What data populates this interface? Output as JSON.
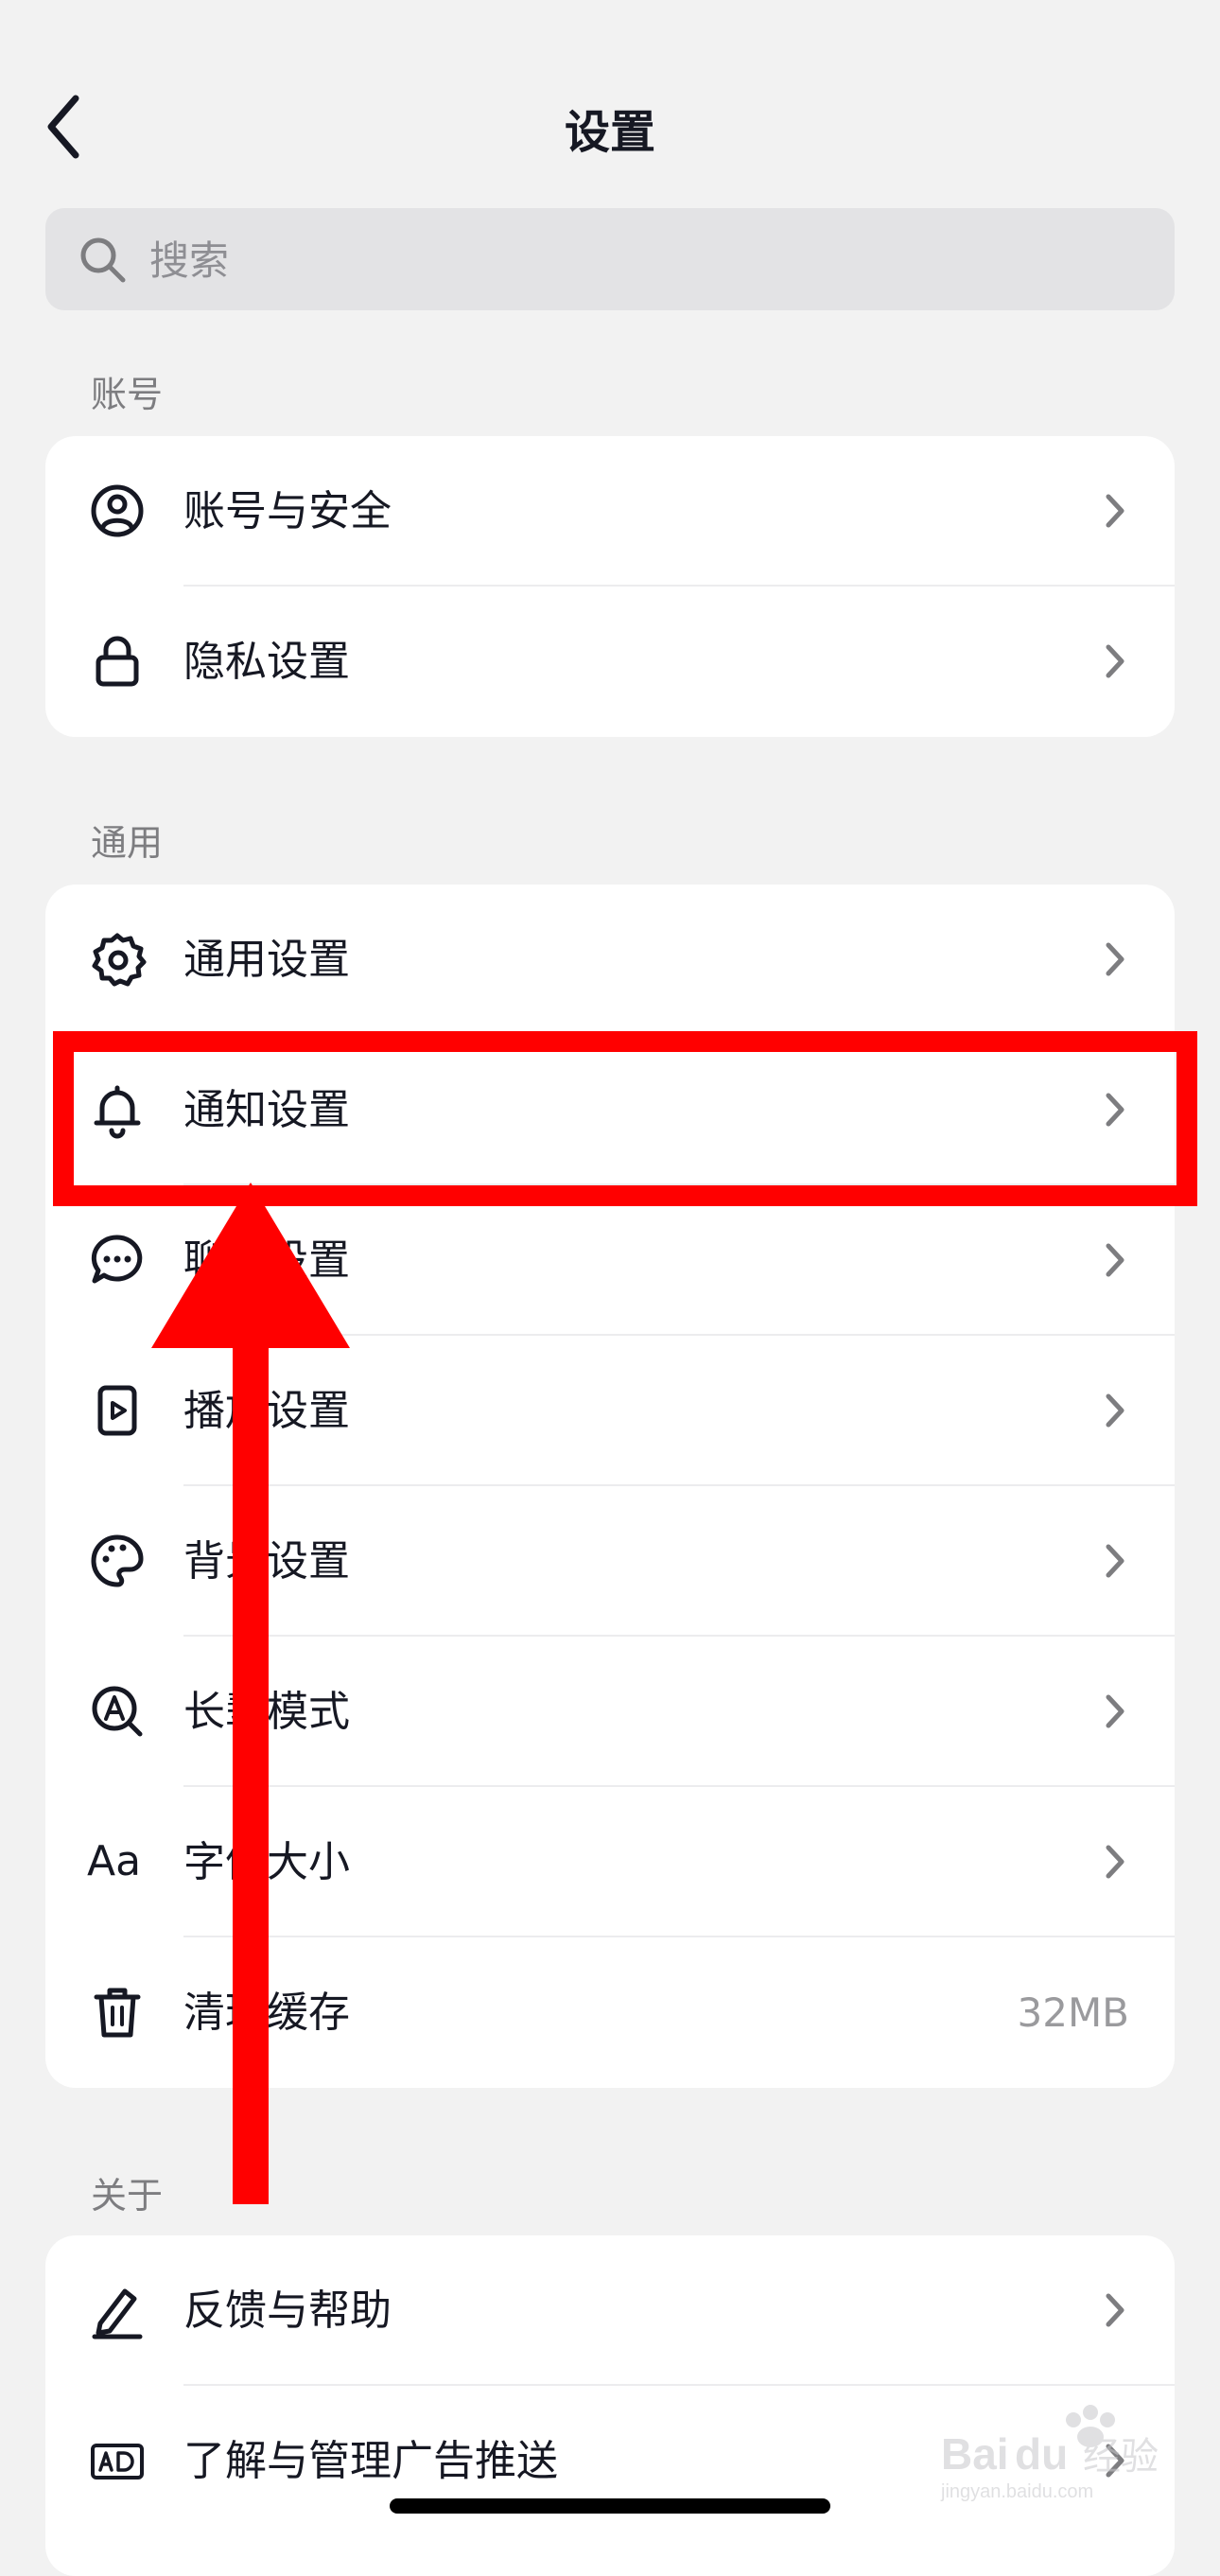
{
  "header": {
    "title": "设置"
  },
  "search": {
    "placeholder": "搜索"
  },
  "sections": {
    "account": {
      "label": "账号",
      "items": {
        "security": "账号与安全",
        "privacy": "隐私设置"
      }
    },
    "general": {
      "label": "通用",
      "items": {
        "general": "通用设置",
        "notify": "通知设置",
        "chat": "聊天设置",
        "play": "播放设置",
        "background": "背景设置",
        "elder": "长辈模式",
        "fontsize": "字体大小",
        "cache": "清理缓存",
        "cache_size": "32MB"
      }
    },
    "about": {
      "label": "关于",
      "items": {
        "feedback": "反馈与帮助",
        "ads": "了解与管理广告推送"
      }
    }
  },
  "icons": {
    "back": "chevron-left-icon",
    "search": "search-icon",
    "account": "user-circle-icon",
    "privacy": "lock-icon",
    "general": "gear-icon",
    "notify": "bell-icon",
    "chat": "chat-bubble-icon",
    "play": "play-file-icon",
    "background": "palette-icon",
    "elder": "font-zoom-icon",
    "fontsize": "text-size-icon",
    "cache": "trash-icon",
    "feedback": "pencil-icon",
    "ads": "ad-badge-icon",
    "aa_glyph": "Aa"
  },
  "annotation": {
    "color": "#ff0000",
    "watermark": "Baidu 经验 jingyan.baidu.com"
  }
}
